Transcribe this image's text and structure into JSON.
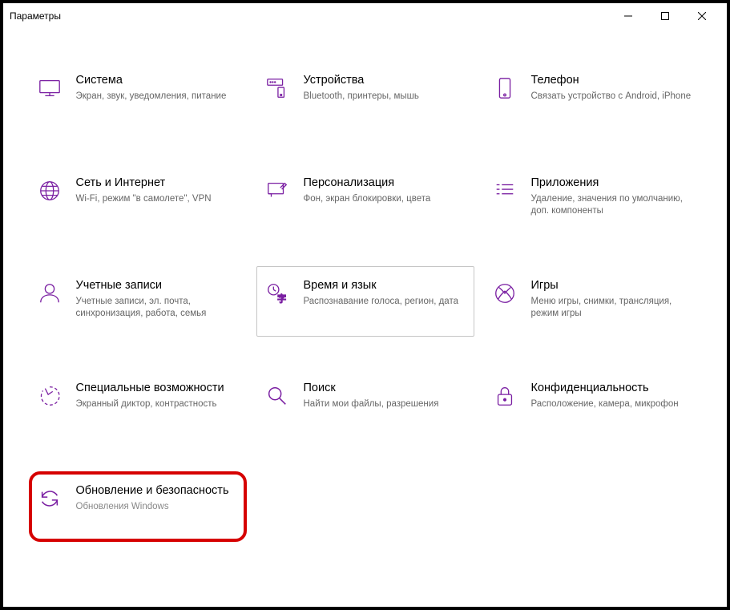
{
  "window": {
    "title": "Параметры"
  },
  "tiles": [
    {
      "id": "system",
      "title": "Система",
      "desc": "Экран, звук, уведомления, питание"
    },
    {
      "id": "devices",
      "title": "Устройства",
      "desc": "Bluetooth, принтеры, мышь"
    },
    {
      "id": "phone",
      "title": "Телефон",
      "desc": "Связать устройство с Android, iPhone"
    },
    {
      "id": "network",
      "title": "Сеть и Интернет",
      "desc": "Wi-Fi, режим \"в самолете\", VPN"
    },
    {
      "id": "personalization",
      "title": "Персонализация",
      "desc": "Фон, экран блокировки, цвета"
    },
    {
      "id": "apps",
      "title": "Приложения",
      "desc": "Удаление, значения по умолчанию, доп. компоненты"
    },
    {
      "id": "accounts",
      "title": "Учетные записи",
      "desc": "Учетные записи, эл. почта, синхронизация, работа, семья"
    },
    {
      "id": "time-language",
      "title": "Время и язык",
      "desc": "Распознавание голоса, регион, дата",
      "hovered": true
    },
    {
      "id": "gaming",
      "title": "Игры",
      "desc": "Меню игры, снимки, трансляция, режим игры"
    },
    {
      "id": "ease-of-access",
      "title": "Специальные возможности",
      "desc": "Экранный диктор, контрастность"
    },
    {
      "id": "search",
      "title": "Поиск",
      "desc": "Найти мои файлы, разрешения"
    },
    {
      "id": "privacy",
      "title": "Конфиденциальность",
      "desc": "Расположение, камера, микрофон"
    },
    {
      "id": "update-security",
      "title": "Обновление и безопасность",
      "desc": "Обновления Windows",
      "highlighted": true
    }
  ],
  "colors": {
    "accent": "#7a1fa2",
    "highlight_border": "#d60000"
  }
}
